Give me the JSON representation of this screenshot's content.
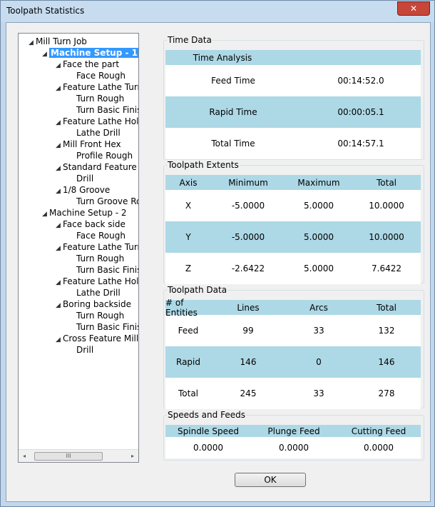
{
  "window": {
    "title": "Toolpath Statistics",
    "close_glyph": "✕"
  },
  "tree": {
    "items": [
      {
        "label": "Mill Turn Job",
        "level": 0,
        "expanded": true
      },
      {
        "label": "Machine Setup - 1",
        "level": 1,
        "expanded": true,
        "selected": true
      },
      {
        "label": "Face the part",
        "level": 2,
        "expanded": true
      },
      {
        "label": "Face Rough",
        "level": 3
      },
      {
        "label": "Feature Lathe Turning",
        "level": 2,
        "expanded": true
      },
      {
        "label": "Turn Rough",
        "level": 3
      },
      {
        "label": "Turn Basic Finish",
        "level": 3
      },
      {
        "label": "Feature Lathe Holes",
        "level": 2,
        "expanded": true
      },
      {
        "label": "Lathe Drill",
        "level": 3
      },
      {
        "label": "Mill Front Hex",
        "level": 2,
        "expanded": true
      },
      {
        "label": "Profile Rough",
        "level": 3
      },
      {
        "label": "Standard Feature Mill",
        "level": 2,
        "expanded": true
      },
      {
        "label": "Drill",
        "level": 3
      },
      {
        "label": "1/8 Groove",
        "level": 2,
        "expanded": true
      },
      {
        "label": "Turn Groove Roug",
        "level": 3
      },
      {
        "label": "Machine Setup - 2",
        "level": 1,
        "expanded": true
      },
      {
        "label": "Face back side",
        "level": 2,
        "expanded": true
      },
      {
        "label": "Face Rough",
        "level": 3
      },
      {
        "label": "Feature Lathe Turning",
        "level": 2,
        "expanded": true
      },
      {
        "label": "Turn Rough",
        "level": 3
      },
      {
        "label": "Turn Basic Finish",
        "level": 3
      },
      {
        "label": "Feature Lathe Holes",
        "level": 2,
        "expanded": true
      },
      {
        "label": "Lathe Drill",
        "level": 3
      },
      {
        "label": "Boring backside",
        "level": 2,
        "expanded": true
      },
      {
        "label": "Turn Rough",
        "level": 3
      },
      {
        "label": "Turn Basic Finish",
        "level": 3
      },
      {
        "label": "Cross Feature Mill Ho",
        "level": 2,
        "expanded": true
      },
      {
        "label": "Drill",
        "level": 3
      }
    ],
    "scroll": {
      "left_glyph": "◂",
      "right_glyph": "▸",
      "thumb_glyph": "III"
    }
  },
  "time_data": {
    "title": "Time Data",
    "header": "Time Analysis",
    "rows": [
      {
        "label": "Feed Time",
        "value": "00:14:52.0"
      },
      {
        "label": "Rapid Time",
        "value": "00:00:05.1"
      },
      {
        "label": "Total Time",
        "value": "00:14:57.1"
      }
    ]
  },
  "extents": {
    "title": "Toolpath Extents",
    "headers": [
      "Axis",
      "Minimum",
      "Maximum",
      "Total"
    ],
    "rows": [
      [
        "X",
        "-5.0000",
        "5.0000",
        "10.0000"
      ],
      [
        "Y",
        "-5.0000",
        "5.0000",
        "10.0000"
      ],
      [
        "Z",
        "-2.6422",
        "5.0000",
        "7.6422"
      ]
    ]
  },
  "toolpath_data": {
    "title": "Toolpath Data",
    "headers": [
      "# of Entities",
      "Lines",
      "Arcs",
      "Total"
    ],
    "rows": [
      [
        "Feed",
        "99",
        "33",
        "132"
      ],
      [
        "Rapid",
        "146",
        "0",
        "146"
      ],
      [
        "Total",
        "245",
        "33",
        "278"
      ]
    ]
  },
  "speeds": {
    "title": "Speeds and Feeds",
    "headers": [
      "Spindle Speed",
      "Plunge Feed",
      "Cutting Feed"
    ],
    "values": [
      "0.0000",
      "0.0000",
      "0.0000"
    ]
  },
  "buttons": {
    "ok": "OK"
  },
  "colors": {
    "header_bg": "#add8e6",
    "selection": "#3399ff",
    "close": "#c7463a"
  }
}
